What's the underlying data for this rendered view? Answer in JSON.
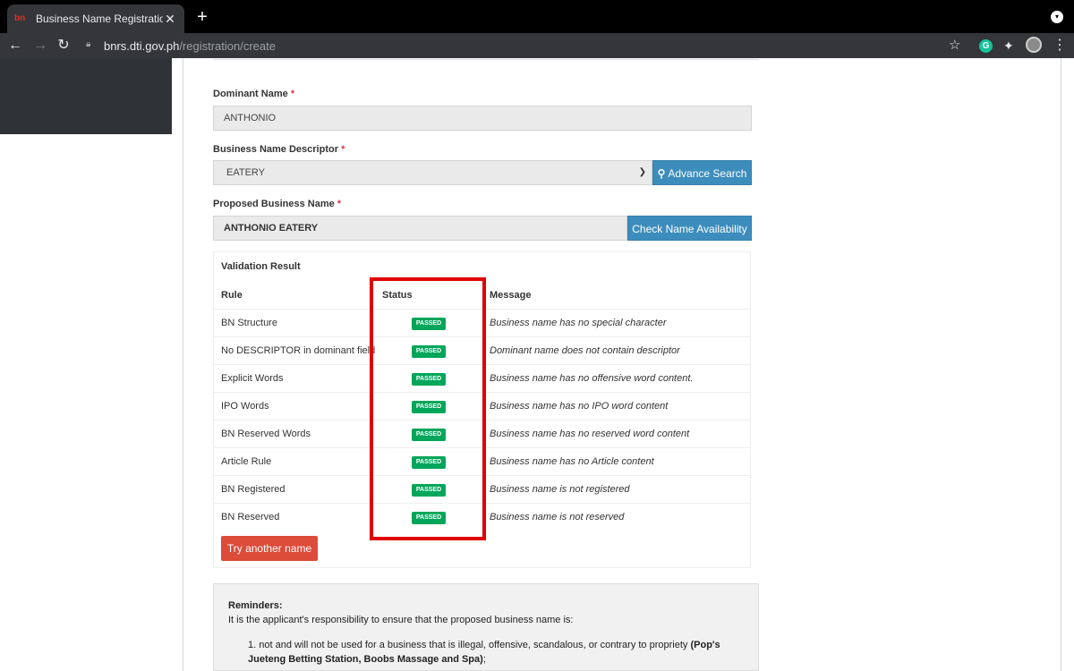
{
  "browser": {
    "tab_title": "Business Name Registration - DTI",
    "favicon_text": "bn",
    "close_glyph": "✕",
    "new_tab_glyph": "+",
    "url_host": "bnrs.dti.gov.ph",
    "url_path": "/registration/create",
    "ext_letter": "G"
  },
  "form": {
    "dominant_label": "Dominant Name",
    "dominant_value": "ANTHONIO",
    "descriptor_label": "Business Name Descriptor",
    "descriptor_value": "EATERY",
    "advance_search_label": "Advance Search",
    "proposed_label": "Proposed Business Name",
    "proposed_value": "ANTHONIO EATERY",
    "check_availability_label": "Check Name Availability",
    "required_mark": "*"
  },
  "validation": {
    "title": "Validation Result",
    "headers": {
      "rule": "Rule",
      "status": "Status",
      "message": "Message"
    },
    "rows": [
      {
        "rule": "BN Structure",
        "status": "PASSED",
        "message": "Business name has no special character"
      },
      {
        "rule": "No DESCRIPTOR in dominant field",
        "status": "PASSED",
        "message": "Dominant name does not contain descriptor"
      },
      {
        "rule": "Explicit Words",
        "status": "PASSED",
        "message": "Business name has no offensive word content."
      },
      {
        "rule": "IPO Words",
        "status": "PASSED",
        "message": "Business name has no IPO word content"
      },
      {
        "rule": "BN Reserved Words",
        "status": "PASSED",
        "message": "Business name has no reserved word content"
      },
      {
        "rule": "Article Rule",
        "status": "PASSED",
        "message": "Business name has no Article content"
      },
      {
        "rule": "BN Registered",
        "status": "PASSED",
        "message": "Business name is not registered"
      },
      {
        "rule": "BN Reserved",
        "status": "PASSED",
        "message": "Business name is not reserved"
      }
    ],
    "try_another_label": "Try another name"
  },
  "reminders": {
    "title": "Reminders:",
    "intro": "It is the applicant's responsibility to ensure that the proposed business name is:",
    "item1_text": "1. not and will not be used for a business that is illegal, offensive, scandalous, or contrary to propriety ",
    "item1_bold": "(Pop's Jueteng Betting Station, Boobs Massage and Spa)",
    "item1_end": ";"
  },
  "colors": {
    "passed": "#00a65a",
    "primary": "#3c8dbc",
    "danger": "#dd4b39",
    "highlight": "#e00000"
  }
}
